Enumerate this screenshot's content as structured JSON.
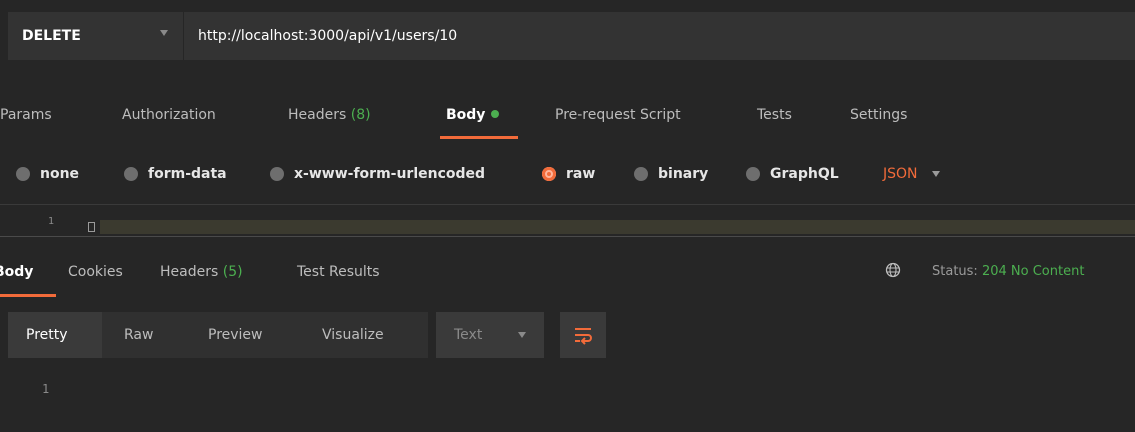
{
  "request": {
    "method": "DELETE",
    "url": "http://localhost:3000/api/v1/users/10"
  },
  "request_tabs": [
    {
      "label": "Params"
    },
    {
      "label": "Authorization"
    },
    {
      "label": "Headers",
      "count": "(8)"
    },
    {
      "label": "Body",
      "active": true
    },
    {
      "label": "Pre-request Script"
    },
    {
      "label": "Tests"
    },
    {
      "label": "Settings"
    }
  ],
  "body_types": [
    {
      "label": "none"
    },
    {
      "label": "form-data"
    },
    {
      "label": "x-www-form-urlencoded"
    },
    {
      "label": "raw",
      "checked": true
    },
    {
      "label": "binary"
    },
    {
      "label": "GraphQL"
    }
  ],
  "body_format": "JSON",
  "editor": {
    "line_number": "1"
  },
  "response_tabs": [
    {
      "label": "Body",
      "active": true
    },
    {
      "label": "Cookies"
    },
    {
      "label": "Headers",
      "count": "(5)"
    },
    {
      "label": "Test Results"
    }
  ],
  "status": {
    "label": "Status:",
    "value": "204 No Content"
  },
  "response_view": {
    "modes": [
      "Pretty",
      "Raw",
      "Preview",
      "Visualize"
    ],
    "active_mode": "Pretty",
    "format": "Text"
  },
  "response_body": {
    "line_number": "1"
  },
  "icons": {
    "globe": "globe-icon",
    "wrap": "wrap-lines-icon",
    "method_caret": "chevron-down-icon"
  },
  "colors": {
    "accent": "#f26b3a",
    "success": "#4caf50",
    "background": "#262626",
    "panel": "#333333"
  }
}
